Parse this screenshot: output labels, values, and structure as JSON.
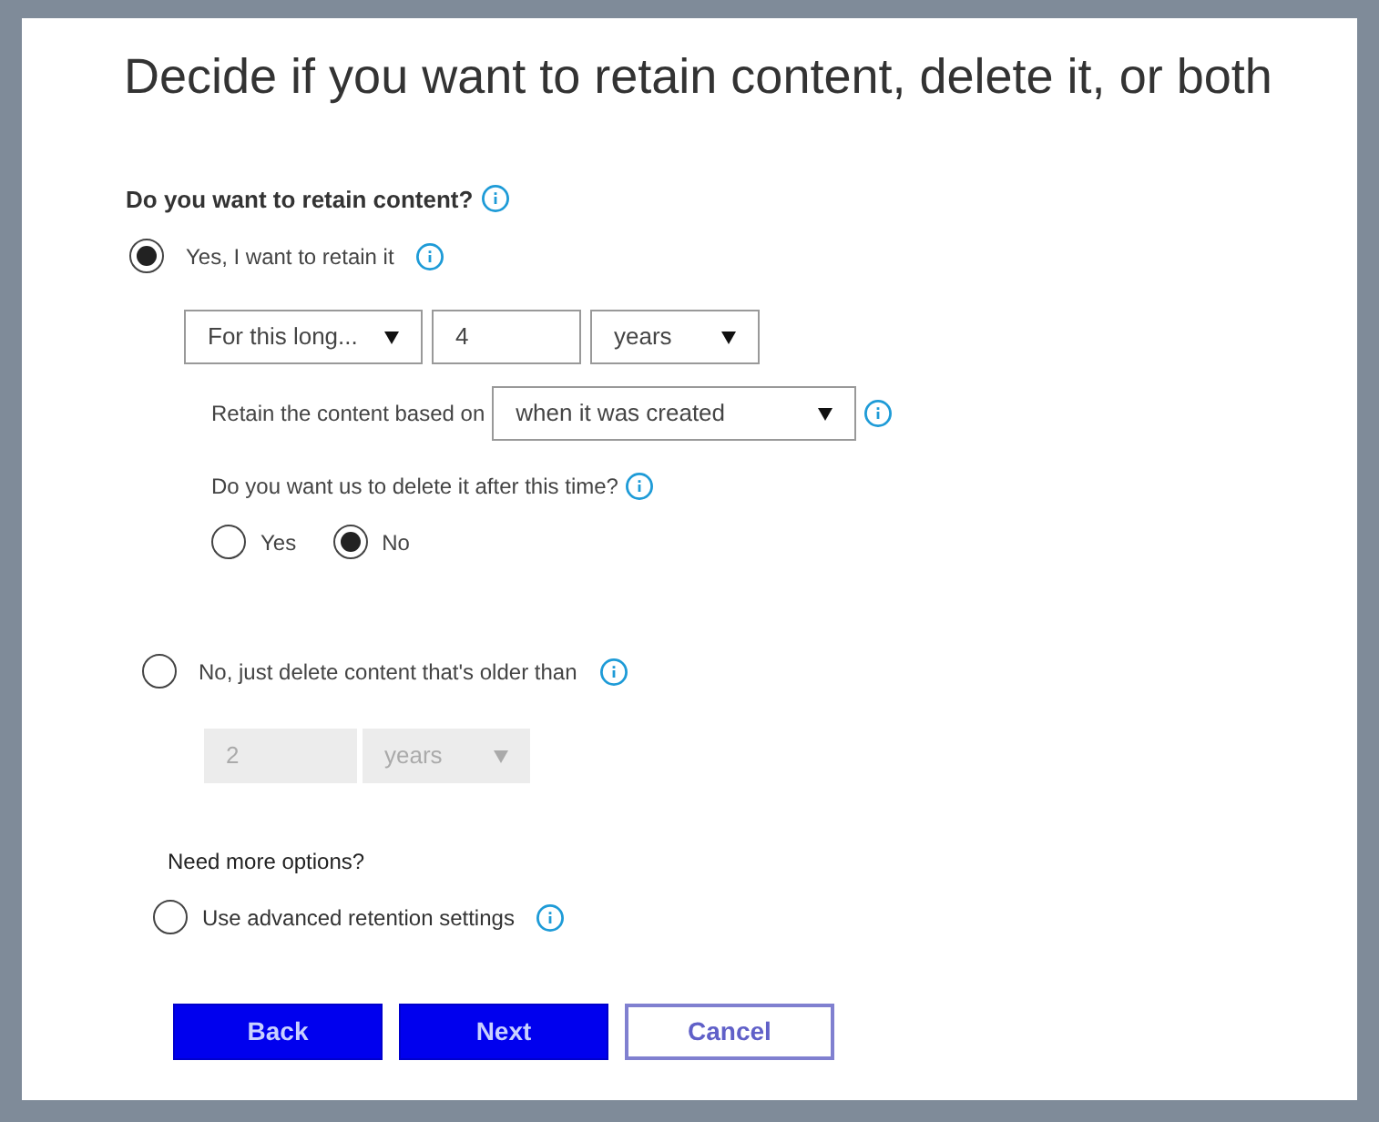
{
  "title": "Decide if you want to retain content, delete it, or both",
  "question": {
    "label": "Do you want to retain content?"
  },
  "retain": {
    "label": "Yes, I want to retain it",
    "selected": true
  },
  "duration": {
    "mode": "For this long...",
    "amount": "4",
    "unit": "years"
  },
  "based_on": {
    "label": "Retain the content based on",
    "value": "when it was created"
  },
  "delete_after": {
    "label": "Do you want us to delete it after this time?",
    "options": [
      {
        "label": "Yes",
        "selected": false
      },
      {
        "label": "No",
        "selected": true
      }
    ]
  },
  "delete_only": {
    "label": "No, just delete content that's older than",
    "selected": false,
    "amount": "2",
    "unit": "years",
    "disabled": true
  },
  "more_options": {
    "label": "Need more options?"
  },
  "advanced": {
    "label": "Use advanced retention settings",
    "selected": false
  },
  "buttons": [
    {
      "label": "Back",
      "kind": "primary"
    },
    {
      "label": "Next",
      "kind": "primary"
    },
    {
      "label": "Cancel",
      "kind": "secondary"
    }
  ]
}
